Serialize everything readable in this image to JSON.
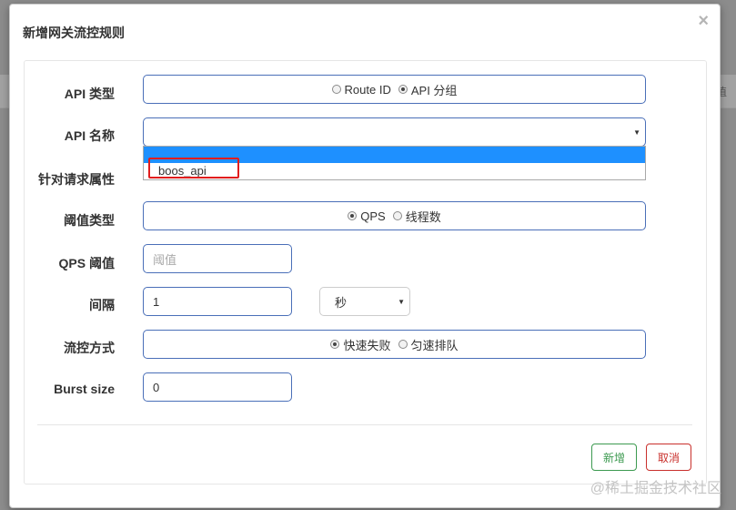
{
  "dialog": {
    "title": "新增网关流控规则",
    "close_symbol": "×"
  },
  "backdrop": {
    "partial_text": "值"
  },
  "form": {
    "api_type": {
      "label": "API 类型",
      "options": [
        {
          "label": "Route ID",
          "checked": false
        },
        {
          "label": "API 分组",
          "checked": true
        }
      ]
    },
    "api_name": {
      "label": "API 名称",
      "value": "",
      "dropdown_options": [
        "",
        "boos_api"
      ],
      "highlighted_option": "boos_api"
    },
    "request_attr": {
      "label": "针对请求属性"
    },
    "threshold_type": {
      "label": "阈值类型",
      "options": [
        {
          "label": "QPS",
          "checked": true
        },
        {
          "label": "线程数",
          "checked": false
        }
      ]
    },
    "qps_threshold": {
      "label": "QPS 阈值",
      "value": "",
      "placeholder": "阈值"
    },
    "interval": {
      "label": "间隔",
      "value": "1",
      "unit": "秒"
    },
    "control_mode": {
      "label": "流控方式",
      "options": [
        {
          "label": "快速失败",
          "checked": true
        },
        {
          "label": "匀速排队",
          "checked": false
        }
      ]
    },
    "burst_size": {
      "label": "Burst size",
      "value": "0"
    }
  },
  "buttons": {
    "add": "新增",
    "cancel": "取消"
  },
  "watermark": "@稀土掘金技术社区",
  "colors": {
    "input_border": "#4a6fb8",
    "selected_option": "#1e90ff",
    "highlight_box": "#e11d1d",
    "add_button": "#3c9a50",
    "cancel_button": "#c9302c"
  }
}
